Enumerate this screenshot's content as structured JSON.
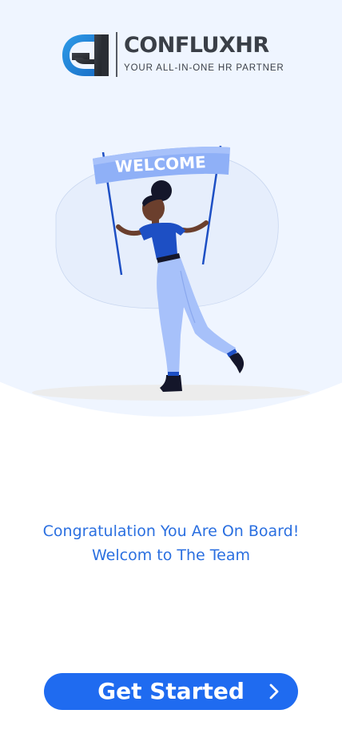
{
  "brand": {
    "name_main": "CONFLUX",
    "name_accent": "HR",
    "tagline": "YOUR ALL-IN-ONE HR PARTNER"
  },
  "illustration": {
    "banner_text": "WELCOME"
  },
  "message": {
    "line1": "Congratulation You Are On Board!",
    "line2": "Welcom to The Team"
  },
  "cta": {
    "label": "Get Started",
    "icon": "chevron-right-icon"
  },
  "colors": {
    "accent": "#2a6fe0",
    "button": "#1f6bf0",
    "background_blob": "#eff5ff",
    "logo_dark": "#3a3f47"
  }
}
